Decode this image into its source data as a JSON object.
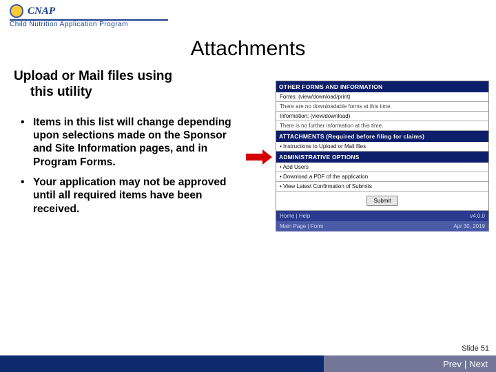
{
  "logo": {
    "brand": "CNAP",
    "sub": "Child Nutrition Application Program"
  },
  "title": "Attachments",
  "subhead_line1": "Upload or Mail files using",
  "subhead_line2": "this utility",
  "bullets": [
    "Items in this list will change depending upon selections made on the Sponsor and Site Information pages, and in Program Forms.",
    "Your application may not be approved until all required items have been received."
  ],
  "shot": {
    "s1_title": "OTHER FORMS AND INFORMATION",
    "s1_a": "Forms: (view/download/print)",
    "s1_b": "There are no downloadable forms at this time.",
    "s1_c": "Information: (view/download)",
    "s1_d": "There is no further information at this time.",
    "s2_title": "ATTACHMENTS (Required before filing for claims)",
    "s2_a": "• Instructions to Upload or Mail files",
    "s3_title": "ADMINISTRATIVE OPTIONS",
    "s3_a": "• Add Users",
    "s3_b": "• Download a PDF of the application",
    "s3_c": "• View Latest Confirmation of Submits",
    "btn": "Submit",
    "f1a": "Home | Help",
    "f1b": "v4.0.0",
    "f2a": "Main Page | Form",
    "f2b": "Apr 30, 2019"
  },
  "slidenum": "Slide 51",
  "nav": {
    "prev": "Prev",
    "sep": "|",
    "next": "Next"
  }
}
